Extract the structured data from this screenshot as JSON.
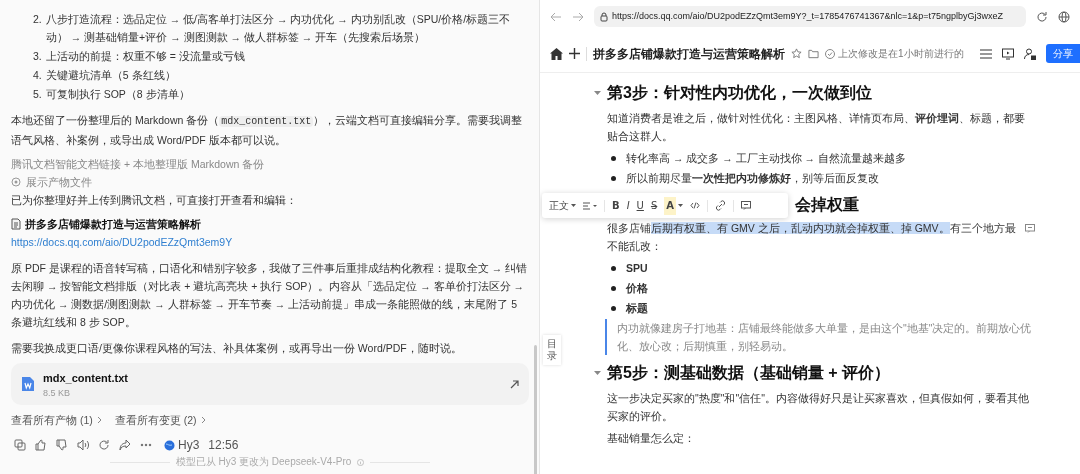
{
  "chat": {
    "list_items": [
      {
        "number": "2.",
        "text": "八步打造流程：选品定位 → 低/高客单打法区分 → 内功优化 → 内功别乱改（SPU/价格/标题三不动） → 测基础销量+评价 → 测图测款 → 做人群标签 → 开车（先搜索后场景）"
      },
      {
        "number": "3.",
        "text": "上活动的前提：权重不够 = 没流量或亏钱"
      },
      {
        "number": "4.",
        "text": "关键避坑清单（5 条红线）"
      },
      {
        "number": "5.",
        "text": "可复制执行 SOP（8 步清单）"
      }
    ],
    "backup_note": {
      "before": "本地还留了一份整理后的 Markdown 备份（",
      "code": "mdx_content.txt",
      "after": "），云端文档可直接编辑分享。需要我调整语气风格、补案例，或导出成 Word/PDF 版本都可以说。"
    },
    "sources_caption": "腾讯文档智能文档链接 + 本地整理版 Markdown 备份",
    "artifacts_toggle": "展示产物文件",
    "intro": "已为你整理好并上传到腾讯文档，可直接打开查看和编辑：",
    "doc_title": "拼多多店铺爆款打造与运营策略解析",
    "doc_link": "https://docs.qq.com/aio/DU2podEZzQmt3em9Y",
    "summary": "原 PDF 是课程的语音转写稿，口语化和错别字较多，我做了三件事后重排成结构化教程：提取全文 → 纠错去闲聊 → 按智能文档排版（对比表 + 避坑高亮块 + 执行 SOP）。内容从「选品定位 → 客单价打法区分 → 内功优化 → 测数据/测图测款 → 人群标签 → 开车节奏 → 上活动前提」串成一条能照做的线，末尾附了 5 条避坑红线和 8 步 SOP。",
    "followup": "需要我换成更口语/更像你课程风格的写法、补具体案例，或再导出一份 Word/PDF，随时说。",
    "file_card": {
      "name": "mdx_content.txt",
      "size": "8.5 KB"
    },
    "links": [
      "查看所有产物 (1)",
      "查看所有变更 (2)"
    ],
    "model": "Hy3",
    "time": "12:56",
    "footer_note": "模型已从 Hy3 更改为 Deepseek-V4-Pro"
  },
  "browser": {
    "url": "https://docs.qq.com/aio/DU2podEZzQmt3em9Y?_t=1785476741367&nlc=1&p=t75ngplbyGj3wxeZ"
  },
  "doc": {
    "title": "拼多多店铺爆款打造与运营策略解析",
    "last_modified": "上次修改是在1小时前进行的",
    "share_button": "分享",
    "toc_tab": "目录",
    "toolbar": {
      "style_label": "正文",
      "format_buttons": [
        "B",
        "I",
        "U",
        "S",
        "A"
      ]
    },
    "blocks": [
      {
        "kind": "heading",
        "text": "第3步：针对性内功优化，一次做到位"
      },
      {
        "kind": "paragraph",
        "text": "知道消费者是谁之后，做针对性优化：主图风格、详情页布局、**评价埋词**、标题，都要贴合这群人。"
      },
      {
        "kind": "bullet",
        "text": "转化率高 → 成交多 → 工厂主动找你 → 自然流量越来越多"
      },
      {
        "kind": "bullet",
        "text": "所以前期尽量**一次性把内功修炼好**，别等后面反复改"
      },
      {
        "kind": "partial_heading",
        "text": "会掉权重"
      },
      {
        "kind": "selection_paragraph",
        "segments": [
          {
            "text": "很多店铺",
            "selected": false
          },
          {
            "text": "后期有权重、有 GMV 之后，乱动内功就会掉权重、掉 GMV。",
            "selected": true
          },
          {
            "text": "有三个地方最不能乱改：",
            "selected": false
          }
        ]
      },
      {
        "kind": "bullet",
        "text": "**SPU**"
      },
      {
        "kind": "bullet",
        "text": "**价格**"
      },
      {
        "kind": "bullet",
        "text": "**标题**"
      },
      {
        "kind": "quote",
        "text": "内功就像建房子打地基：店铺最终能做多大单量，是由这个\"地基\"决定的。前期放心优化、放心改；后期慎重，别轻易动。"
      },
      {
        "kind": "heading",
        "text": "第5步：测基础数据（基础销量 + 评价）"
      },
      {
        "kind": "paragraph",
        "text": "这一步决定买家的\"热度\"和\"信任\"。内容做得好只是让买家喜欢，但真假如何，要看其他买家的评价。"
      },
      {
        "kind": "paragraph",
        "text": "基础销量怎么定："
      }
    ]
  }
}
